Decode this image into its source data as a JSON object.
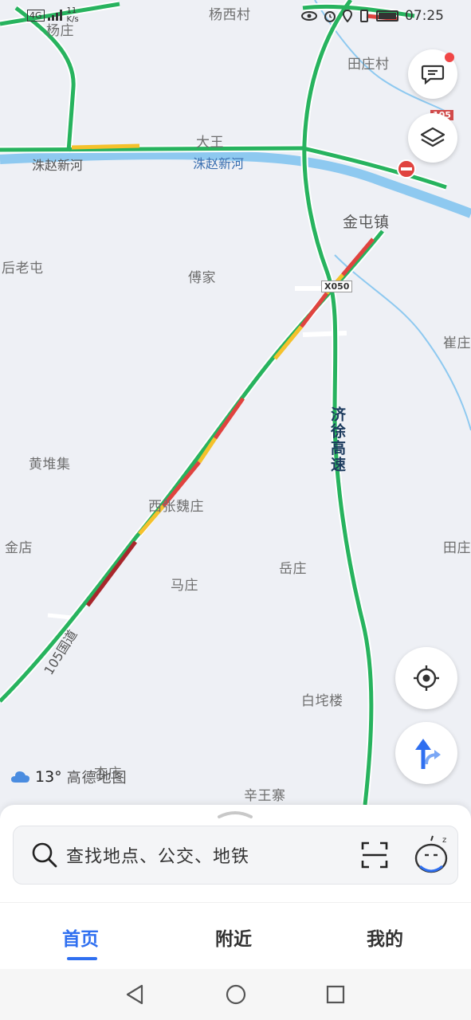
{
  "status_bar": {
    "network": "4G",
    "speed": "11",
    "speed_unit": "K/s",
    "time": "07:25"
  },
  "map": {
    "place_labels": [
      "杨庄",
      "杨西村",
      "田庄村",
      "大王",
      "金屯镇",
      "后老屯",
      "傅家",
      "崔庄",
      "黄堆集",
      "西张魏庄",
      "金店",
      "马庄",
      "岳庄",
      "田庄",
      "白垞楼",
      "杏庄",
      "辛王寨"
    ],
    "river_labels": [
      "洙赵新河",
      "洙赵新河"
    ],
    "highway_label": "济徐高速",
    "road_label": "105国道",
    "road_shields": [
      "X050",
      "105"
    ],
    "colors": {
      "road_clear": "#27b35e",
      "road_slow": "#f5c12b",
      "road_jam": "#e0433f",
      "road_heavy": "#a8262b",
      "river": "#8ec9f0",
      "accent": "#2f6ff0"
    }
  },
  "buttons": {
    "messages_icon": "message-icon",
    "layers_icon": "layers-icon",
    "locate_icon": "locate-icon",
    "route_icon": "route-icon"
  },
  "weather": {
    "temperature": "13°",
    "brand": "高德地图"
  },
  "search": {
    "placeholder": "查找地点、公交、地铁"
  },
  "tabs": [
    {
      "label": "首页",
      "active": true
    },
    {
      "label": "附近",
      "active": false
    },
    {
      "label": "我的",
      "active": false
    }
  ]
}
